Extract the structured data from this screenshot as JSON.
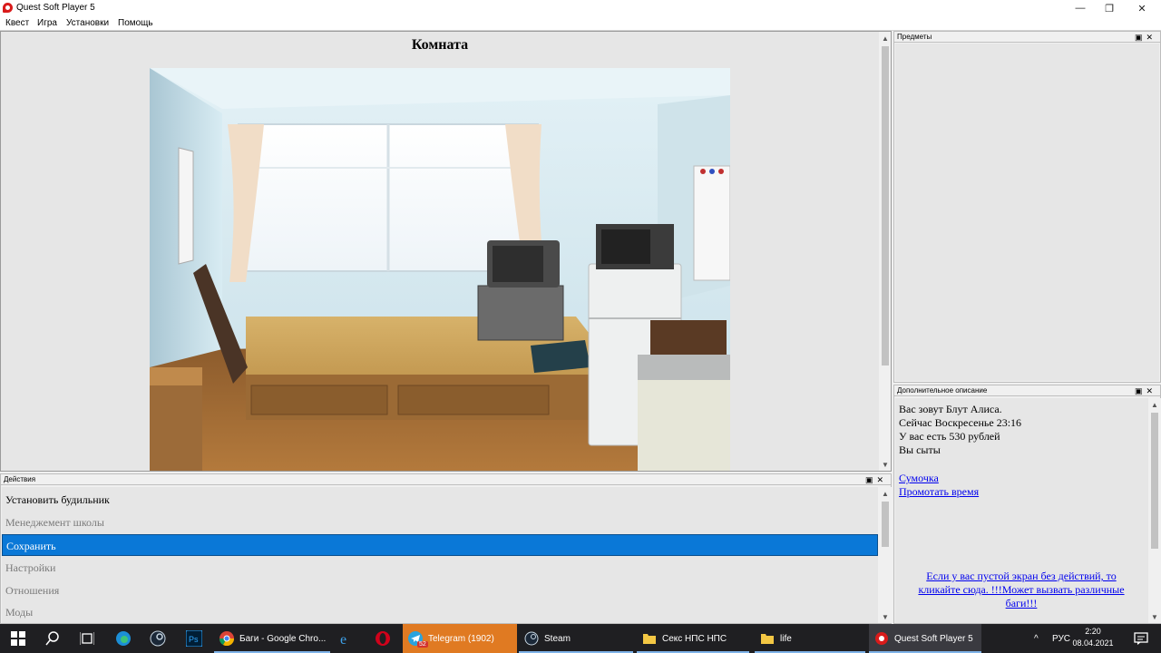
{
  "window": {
    "title": "Quest Soft Player 5",
    "minimize_glyph": "—",
    "maximize_glyph": "❐",
    "close_glyph": "✕"
  },
  "menu": [
    "Квест",
    "Игра",
    "Установки",
    "Помощь"
  ],
  "main": {
    "room_title": "Комната"
  },
  "items_panel": {
    "title": "Предметы",
    "buttons": "▣✕"
  },
  "extra_panel": {
    "title": "Дополнительное описание",
    "buttons": "▣✕",
    "lines": [
      "Вас зовут Блут Алиса.",
      "Сейчас Воскресенье 23:16",
      "У вас есть 530 рублей",
      "Вы сыты"
    ],
    "links": [
      "Сумочка",
      "Промотать время"
    ],
    "warning": "Если у вас пустой экран без действий, то кликайте сюда. !!!Может вызвать различные баги!!!"
  },
  "actions_panel": {
    "title": "Действия",
    "buttons": "▣✕",
    "items": [
      {
        "label": "Установить будильник",
        "state": "enabled"
      },
      {
        "label": "Менеджемент школы",
        "state": "disabled"
      },
      {
        "label": "Сохранить",
        "state": "selected"
      },
      {
        "label": "Настройки",
        "state": "disabled"
      },
      {
        "label": "Отношения",
        "state": "disabled"
      },
      {
        "label": "Моды",
        "state": "disabled"
      }
    ]
  },
  "taskbar": {
    "apps": [
      {
        "label": "Баги - Google Chro...",
        "icon": "chrome-icon"
      },
      {
        "label": "Telegram (1902)",
        "icon": "telegram-icon",
        "badge": "52"
      },
      {
        "label": "Steam",
        "icon": "steam-icon"
      },
      {
        "label": "Секс НПС НПС",
        "icon": "folder-icon"
      },
      {
        "label": "life",
        "icon": "folder-icon"
      },
      {
        "label": "Quest Soft Player 5",
        "icon": "quest-player-icon"
      }
    ],
    "tray_chevron": "^",
    "language": "РУС",
    "time": "2:20",
    "date": "08.04.2021"
  }
}
